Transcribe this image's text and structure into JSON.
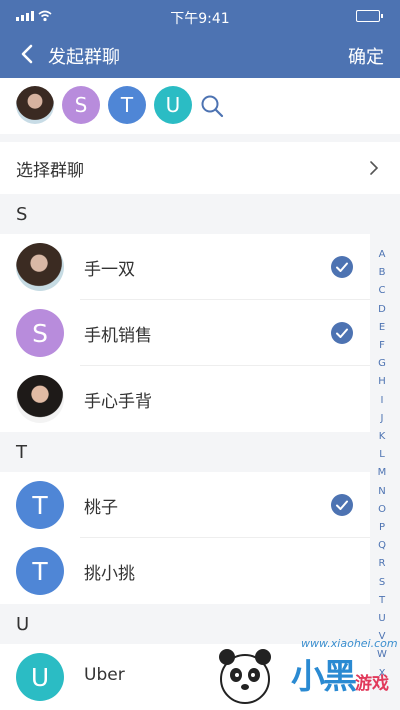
{
  "status_bar": {
    "time": "下午9:41"
  },
  "nav": {
    "back_icon": "chevron-left-icon",
    "title": "发起群聊",
    "confirm": "确定"
  },
  "selected": [
    {
      "kind": "photo",
      "letter": ""
    },
    {
      "kind": "letter",
      "letter": "S",
      "color": "#b88cdc"
    },
    {
      "kind": "letter",
      "letter": "T",
      "color": "#4f86d6"
    },
    {
      "kind": "letter",
      "letter": "U",
      "color": "#2bbcc4"
    }
  ],
  "search_icon": "search-icon",
  "group_select": {
    "label": "选择群聊",
    "icon": "chevron-right-icon"
  },
  "sections": [
    {
      "letter": "S",
      "contacts": [
        {
          "name": "手一双",
          "avatar": "photo",
          "letter": "",
          "checked": true
        },
        {
          "name": "手机销售",
          "avatar": "letter",
          "letter": "S",
          "color": "#b88cdc",
          "checked": true
        },
        {
          "name": "手心手背",
          "avatar": "photo",
          "letter": "",
          "checked": false
        }
      ]
    },
    {
      "letter": "T",
      "contacts": [
        {
          "name": "桃子",
          "avatar": "letter",
          "letter": "T",
          "color": "#4f86d6",
          "checked": true
        },
        {
          "name": "挑小挑",
          "avatar": "letter",
          "letter": "T",
          "color": "#4f86d6",
          "checked": false
        }
      ]
    },
    {
      "letter": "U",
      "contacts": [
        {
          "name": "Uber",
          "avatar": "letter",
          "letter": "U",
          "color": "#2bbcc4",
          "checked": false
        }
      ]
    }
  ],
  "alphabet": [
    "A",
    "B",
    "C",
    "D",
    "E",
    "F",
    "G",
    "H",
    "I",
    "J",
    "K",
    "L",
    "M",
    "N",
    "O",
    "P",
    "Q",
    "R",
    "S",
    "T",
    "U",
    "V",
    "W",
    "X"
  ],
  "watermark": {
    "url": "www.xiaohei.com",
    "text": "小黑",
    "sub": "游戏"
  },
  "colors": {
    "primary": "#4d73b2",
    "check": "#4d73b2"
  }
}
